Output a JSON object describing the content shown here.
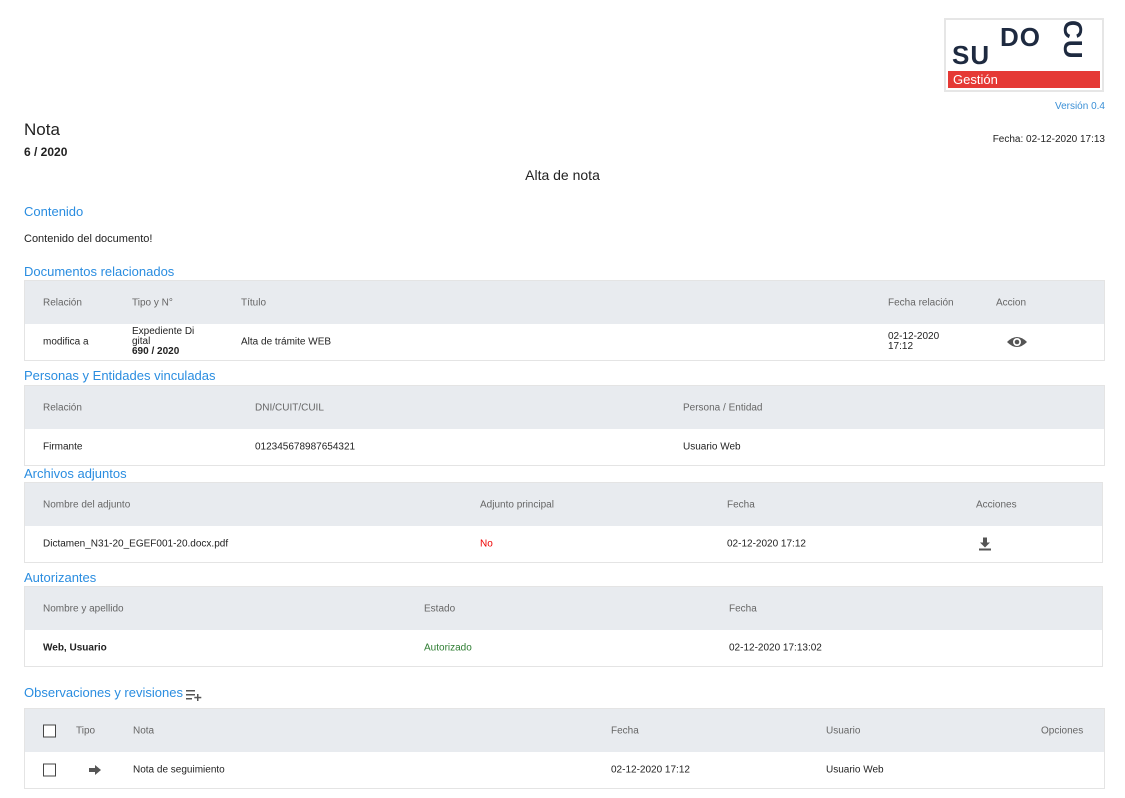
{
  "logo": {
    "su": "SU",
    "do": "DO",
    "cu": "CU",
    "tagline": "Gestión"
  },
  "version": "Versión 0.4",
  "document": {
    "type": "Nota",
    "number": "6 / 2020",
    "date": "Fecha: 02-12-2020 17:13",
    "subject": "Alta de nota"
  },
  "content": {
    "title": "Contenido",
    "text": "Contenido del documento!"
  },
  "related": {
    "title": "Documentos relacionados",
    "headers": [
      "Relación",
      "Tipo y N°",
      "Título",
      "Fecha relación",
      "Accion"
    ],
    "rows": [
      {
        "relation": "modifica a",
        "type_l1": "Expediente Di",
        "type_l2": "gital",
        "type_num": "690 / 2020",
        "title": "Alta de trámite WEB",
        "date_l1": "02-12-2020",
        "date_l2": "17:12",
        "action_icon": "eye-icon"
      }
    ]
  },
  "persons": {
    "title": "Personas y Entidades vinculadas",
    "headers": [
      "Relación",
      "DNI/CUIT/CUIL",
      "Persona / Entidad"
    ],
    "rows": [
      {
        "relation": "Firmante",
        "id": "012345678987654321",
        "entity": "Usuario Web"
      }
    ]
  },
  "attachments": {
    "title": "Archivos adjuntos",
    "headers": [
      "Nombre del adjunto",
      "Adjunto principal",
      "Fecha",
      "Acciones"
    ],
    "rows": [
      {
        "name": "Dictamen_N31-20_EGEF001-20.docx.pdf",
        "main": "No",
        "date": "02-12-2020 17:12",
        "action_icon": "download-icon"
      }
    ],
    "colors": {
      "no": "#e00000"
    }
  },
  "authorizers": {
    "title": "Autorizantes",
    "headers": [
      "Nombre y apellido",
      "Estado",
      "Fecha"
    ],
    "rows": [
      {
        "name": "Web, Usuario",
        "status": "Autorizado",
        "date": "02-12-2020 17:13:02"
      }
    ],
    "colors": {
      "authorized": "#2e7d32"
    }
  },
  "observations": {
    "title": "Observaciones y revisiones",
    "add_icon": "playlist-add-icon",
    "headers": [
      "Tipo",
      "Nota",
      "Fecha",
      "Usuario",
      "Opciones"
    ],
    "rows": [
      {
        "type_icon": "arrow-right-icon",
        "note": "Nota de seguimiento",
        "date": "02-12-2020 17:12",
        "user": "Usuario Web"
      }
    ]
  },
  "colors": {
    "accent": "#2a8de0",
    "brand_red": "#e53935",
    "brand_dark": "#1e2a40",
    "header_bg": "#e8ebef"
  }
}
